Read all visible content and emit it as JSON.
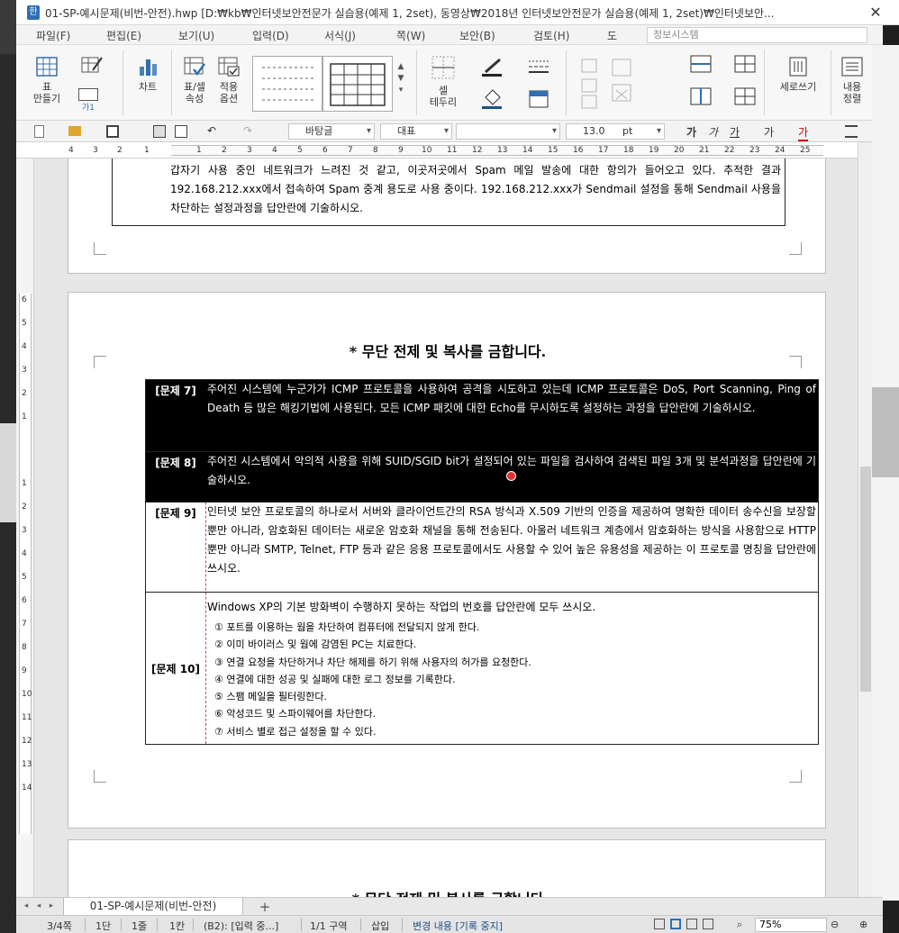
{
  "window": {
    "title": "01-SP-예시문제(비번-안전).hwp [D:₩kb₩인터넷보안전문가 실습용(예제 1, 2set), 동영상₩2018년 인터넷보안전문가 실습용(예제 1, 2set)₩인터넷보안..."
  },
  "menu": {
    "items": [
      "파일(F)",
      "편집(E)",
      "보기(U)",
      "입력(D)",
      "서식(J)",
      "쪽(W)",
      "보안(B)",
      "검토(H)",
      "도"
    ],
    "search_placeholder": "정보시스템"
  },
  "ribbon": {
    "table_make": "표\n만들기",
    "chart": "차트",
    "table_cell_props": "표/셀\n속성",
    "apply_options": "적용\n옵션",
    "cell_border": "셀\n테두리",
    "vertical_writing": "세로쓰기",
    "content_align": "내용\n정렬",
    "gaji": "가1"
  },
  "formatbar": {
    "style": "바탕글",
    "font_class": "대표",
    "font_name": "",
    "font_size": "13.0",
    "unit": "pt",
    "ga_bold": "가",
    "ga_italic": "가",
    "ga_underline": "가",
    "ga_strike": "가",
    "ga_color": "가"
  },
  "ruler": {
    "ticks": [
      "4",
      "3",
      "2",
      "1",
      "1",
      "2",
      "3",
      "4",
      "5",
      "6",
      "7",
      "8",
      "9",
      "10",
      "11",
      "12",
      "13",
      "14",
      "15",
      "16",
      "17",
      "18",
      "19",
      "20",
      "21",
      "22",
      "23",
      "24",
      "25"
    ],
    "vticks": [
      "6",
      "5",
      "4",
      "3",
      "2",
      "1",
      "1",
      "2",
      "3",
      "4",
      "5",
      "6",
      "7",
      "8",
      "9",
      "10",
      "11",
      "12",
      "13",
      "14"
    ]
  },
  "doc": {
    "prev_text": "갑자기 사용 중인 네트워크가 느려진 것 같고, 이곳저곳에서 Spam 메일 발송에 대한 항의가 들어오고 있다. 추적한 결과 192.168.212.xxx에서 접속하여 Spam 중계 용도로 사용 중이다. 192.168.212.xxx가 Sendmail 설정을 통해 Sendmail 사용을 차단하는 설정과정을 답안란에 기술하시오.",
    "notice": "* 무단 전제 및 복사를 금합니다.",
    "notice_next": "* 무단 전제 및 복사를 금합니다",
    "questions": [
      {
        "label": "[문제 7]",
        "text": "주어진 시스템에 누군가가 ICMP 프로토콜을 사용하여 공격을 시도하고 있는데 ICMP 프로토콜은 DoS, Port Scanning, Ping of Death 등 많은 해킹기법에 사용된다. 모든 ICMP 패킷에 대한 Echo를 무시하도록 설정하는 과정을 답안란에 기술하시오."
      },
      {
        "label": "[문제 8]",
        "text": "주어진 시스템에서 악의적 사용을 위해 SUID/SGID bit가 설정되어 있는 파일을 검사하여 검색된 파일 3개 및 분석과정을 답안란에 기술하시오."
      },
      {
        "label": "[문제 9]",
        "text": "인터넷 보안 프로토콜의 하나로서 서버와 클라이언트간의 RSA 방식과 X.509 기반의 인증을 제공하여 명확한 데이터 송수신을 보장할 뿐만 아니라, 암호화된 데이터는 새로운 암호화 채널을 통해 전송된다. 아울러 네트워크 계층에서 암호화하는 방식을 사용함으로 HTTP 뿐만 아니라 SMTP, Telnet, FTP 등과 같은 응용 프로토콜에서도 사용할 수 있어 높은 유용성을 제공하는 이 프로토콜 명칭을 답안란에 쓰시오."
      },
      {
        "label": "[문제 10]",
        "text": "Windows XP의 기본 방화벽이 수행하지 못하는 작업의 번호를 답안란에 모두 쓰시오.",
        "options": [
          "① 포트를 이용하는 웜을 차단하여 컴퓨터에 전달되지 않게 한다.",
          "② 이미 바이러스 및 웜에 감염된 PC는 치료한다.",
          "③ 연결 요청을 차단하거나 차단 해제를 하기 위해 사용자의 허가를 요청한다.",
          "④ 연결에 대한 성공 및 실패에 대한 로그 정보를 기록한다.",
          "⑤ 스팸 메일을 필터링한다.",
          "⑥ 악성코드 및 스파이웨어를 차단한다.",
          "⑦ 서비스 별로 접근 설정을 할 수 있다."
        ]
      }
    ]
  },
  "tabs": {
    "doc_tab": "01-SP-예시문제(비번-안전)",
    "add": "+"
  },
  "status": {
    "page": "3/4쪽",
    "column": "1단",
    "line": "1줄",
    "col": "1칸",
    "cell": "(B2): [입력 중...]",
    "section": "1/1 구역",
    "insert": "삽입",
    "track": "변경 내용 [기록 중지]",
    "zoom": "75%"
  },
  "colors": {
    "accent": "#2f6fb3",
    "highlight_row": "#000000",
    "cursor_dot": "#e03030"
  }
}
